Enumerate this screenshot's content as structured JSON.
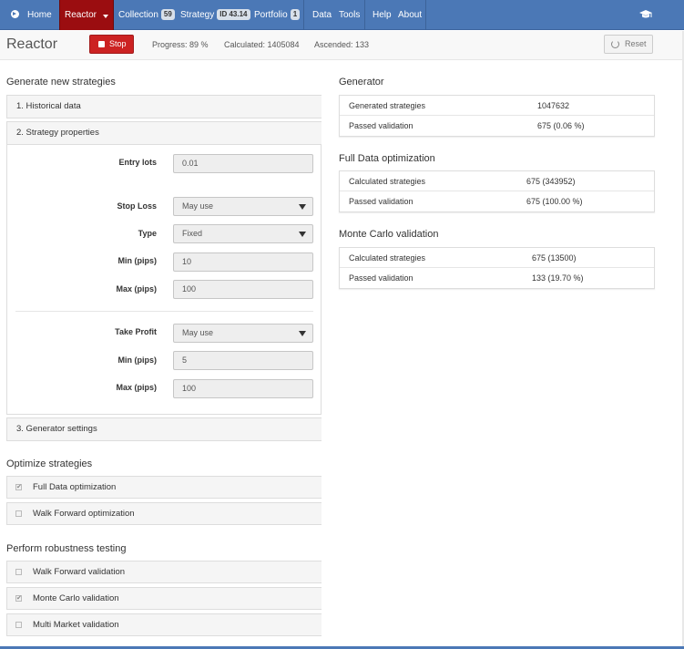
{
  "nav": {
    "home": "Home",
    "reactor": "Reactor",
    "collection": "Collection",
    "collection_badge": "59",
    "strategy": "Strategy",
    "strategy_badge": "ID 43.14",
    "portfolio": "Portfolio",
    "portfolio_badge": "1",
    "data": "Data",
    "tools": "Tools",
    "help": "Help",
    "about": "About",
    "icons": [
      "play-circle-icon",
      "caret-down-icon",
      "graduation-cap-icon"
    ],
    "colors": {
      "navbar": "#4b78b6",
      "active": "#9b0d10"
    }
  },
  "header": {
    "title": "Reactor",
    "stop_label": "Stop",
    "progress": "Progress: 89 %",
    "calculated": "Calculated: 1405084",
    "ascended": "Ascended: 133",
    "reset_label": "Reset"
  },
  "generate": {
    "title": "Generate new strategies",
    "panels": [
      "1. Historical data",
      "2. Strategy properties",
      "3. Generator settings"
    ],
    "form": {
      "entry_lots_label": "Entry lots",
      "entry_lots_value": "0.01",
      "stop_loss_label": "Stop Loss",
      "stop_loss_value": "May use",
      "sl_type_label": "Type",
      "sl_type_value": "Fixed",
      "sl_min_label": "Min (pips)",
      "sl_min_value": "10",
      "sl_max_label": "Max (pips)",
      "sl_max_value": "100",
      "take_profit_label": "Take Profit",
      "take_profit_value": "May use",
      "tp_min_label": "Min (pips)",
      "tp_min_value": "5",
      "tp_max_label": "Max (pips)",
      "tp_max_value": "100"
    }
  },
  "optimize": {
    "title": "Optimize strategies",
    "items": [
      {
        "label": "Full Data optimization",
        "checked": true,
        "mark": "✔"
      },
      {
        "label": "Walk Forward optimization",
        "checked": false,
        "mark": ""
      }
    ]
  },
  "robustness": {
    "title": "Perform robustness testing",
    "items": [
      {
        "label": "Walk Forward validation",
        "checked": false,
        "mark": ""
      },
      {
        "label": "Monte Carlo validation",
        "checked": true,
        "mark": "✔"
      },
      {
        "label": "Multi Market validation",
        "checked": false,
        "mark": ""
      }
    ]
  },
  "generator": {
    "title": "Generator",
    "rows": [
      {
        "label": "Generated strategies",
        "value": "1047632"
      },
      {
        "label": "Passed validation",
        "value": "675 (0.06 %)"
      }
    ]
  },
  "full_data": {
    "title": "Full Data optimization",
    "rows": [
      {
        "label": "Calculated strategies",
        "value": "675 (343952)"
      },
      {
        "label": "Passed validation",
        "value": "675 (100.00 %)"
      }
    ]
  },
  "monte_carlo": {
    "title": "Monte Carlo validation",
    "rows": [
      {
        "label": "Calculated strategies",
        "value": "675 (13500)"
      },
      {
        "label": "Passed validation",
        "value": "133 (19.70 %)"
      }
    ]
  }
}
